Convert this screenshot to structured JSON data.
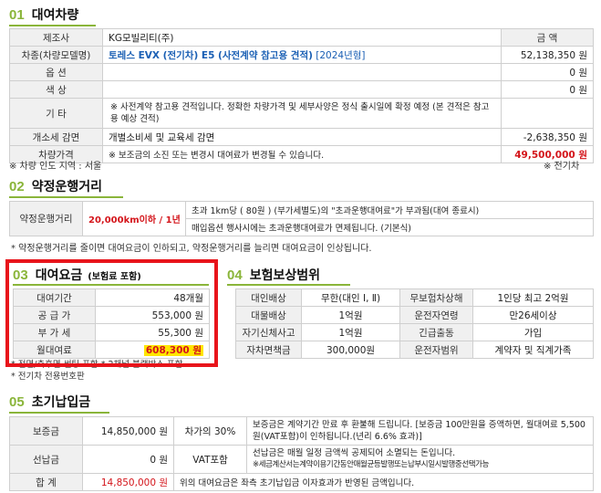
{
  "s1": {
    "num": "01",
    "title": "대여차량",
    "rows": {
      "maker": {
        "label": "제조사",
        "value": "KG모빌리티(주)",
        "right_header": "금 액"
      },
      "model": {
        "label": "차종(차량모델명)",
        "value": "토레스 EVX (전기차) E5 (사전계약 참고용 견적)",
        "year": "[2024년형]",
        "amount": "52,138,350 원"
      },
      "option": {
        "label": "옵 션",
        "amount": "0 원"
      },
      "color": {
        "label": "색 상",
        "amount": "0 원"
      },
      "etc": {
        "label": "기 타",
        "value": "※ 사전계약 참고용 견적입니다. 정확한 차량가격 및 세부사양은 정식 출시일에 확정 예정 (본 견적은 참고용 예상 견적)"
      },
      "tax": {
        "label": "개소세 감면",
        "value": "개별소비세 및 교육세 감면",
        "amount": "-2,638,350 원"
      },
      "price": {
        "label": "차량가격",
        "value": "※ 보조금의 소진 또는 변경시 대여료가 변경될 수 있습니다.",
        "amount": "49,500,000 원"
      }
    },
    "note_left": "※ 차량 인도 지역 : 서울",
    "note_right": "※ 전기차"
  },
  "s2": {
    "num": "02",
    "title": "약정운행거리",
    "label": "약정운행거리",
    "distance": "20,000km이하 / 1년",
    "line1": "초과 1km당 ( 80원 ) (부가세별도)의 \"초과운행대여료\"가 부과됨(대여 종료시)",
    "line2": "매입옵션 행사시에는 초과운행대여료가 면제됩니다. (기본식)",
    "note": "* 약정운행거리를 줄이면 대여요금이 인하되고, 약정운행거리를 늘리면 대여요금이 인상됩니다."
  },
  "s3": {
    "num": "03",
    "title": "대여요금",
    "sub": "(보험료 포함)",
    "rows": [
      {
        "label": "대여기간",
        "value": "48개월"
      },
      {
        "label": "공 급 가",
        "value": "553,000 원"
      },
      {
        "label": "부 가 세",
        "value": "55,300 원"
      },
      {
        "label": "월대여료",
        "value": "608,300 원"
      }
    ],
    "note1": "* 전면/측후면 썬팅 포함   * 2채널 블랙박스 포함",
    "note2": "* 전기차 전용번호판"
  },
  "s4": {
    "num": "04",
    "title": "보험보상범위",
    "rows": [
      [
        "대인배상",
        "무한(대인 Ⅰ, Ⅱ)",
        "무보험차상해",
        "1인당 최고 2억원"
      ],
      [
        "대물배상",
        "1억원",
        "운전자연령",
        "만26세이상"
      ],
      [
        "자기신체사고",
        "1억원",
        "긴급출동",
        "가입"
      ],
      [
        "자차면책금",
        "300,000원",
        "운전자범위",
        "계약자 및 직계가족"
      ]
    ]
  },
  "s5": {
    "num": "05",
    "title": "초기납입금",
    "deposit_label": "보증금",
    "deposit_value": "14,850,000 원",
    "deposit_ratio": "차가의 30%",
    "deposit_desc": "보증금은 계약기간 만료 후 환불해 드립니다. [보증금 100만원을 증액하면, 월대여료 5,500원(VAT포함)이 인하됩니다.(년리 6.6% 효과)]",
    "prepay_label": "선납금",
    "prepay_value": "0 원",
    "prepay_vat": "VAT포함",
    "prepay_desc1": "선납금은 매월 일정 금액씩 공제되어 소멸되는 돈입니다.",
    "prepay_desc2": "※세금계산서는계약이용기간동안매월균등발행또는납부시일시발행중선택가능",
    "total_label": "합 계",
    "total_value": "14,850,000 원",
    "total_desc": "위의 대여요금은 좌측 초기납입금 이자효과가 반영된 금액입니다."
  }
}
